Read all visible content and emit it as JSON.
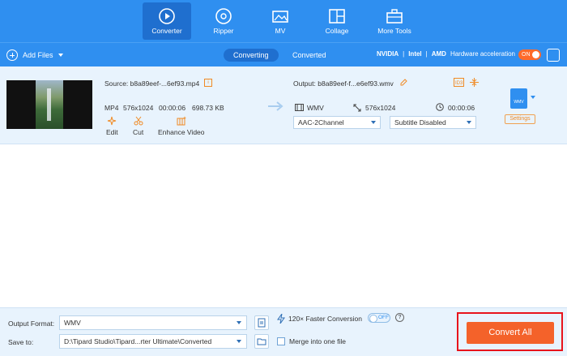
{
  "nav": {
    "tabs": [
      {
        "label": "Converter",
        "icon": "converter-icon",
        "active": true
      },
      {
        "label": "Ripper",
        "icon": "disc-icon"
      },
      {
        "label": "MV",
        "icon": "mv-icon"
      },
      {
        "label": "Collage",
        "icon": "collage-icon"
      },
      {
        "label": "More Tools",
        "icon": "toolbox-icon"
      }
    ]
  },
  "toolbar": {
    "add_files": "Add Files",
    "seg_converting": "Converting",
    "seg_converted": "Converted",
    "hw_nvidia": "NVIDIA",
    "hw_intel": "Intel",
    "hw_amd": "AMD",
    "hw_label": "Hardware acceleration",
    "hw_toggle": "ON"
  },
  "file": {
    "source_label": "Source: b8a89eef-...6ef93.mp4",
    "format": "MP4",
    "resolution": "576x1024",
    "duration": "00:00:06",
    "size": "698.73 KB",
    "edit": "Edit",
    "cut": "Cut",
    "enhance": "Enhance Video",
    "output_label": "Output: b8a89eef-f...e6ef93.wmv",
    "out_format": "WMV",
    "out_resolution": "576x1024",
    "out_duration": "00:00:06",
    "audio": "AAC-2Channel",
    "subtitle": "Subtitle Disabled",
    "fmt_badge": "WMV",
    "settings": "Settings"
  },
  "bottom": {
    "output_format_label": "Output Format:",
    "output_format_value": "WMV",
    "save_to_label": "Save to:",
    "save_to_value": "D:\\Tipard Studio\\Tipard...rter Ultimate\\Converted",
    "faster": "120× Faster Conversion",
    "faster_toggle": "OFF",
    "merge": "Merge into one file",
    "convert_all": "Convert All"
  },
  "colors": {
    "header_blue": "#2f8ff0",
    "accent_orange": "#f4622a",
    "highlight_red": "#e8141c"
  }
}
